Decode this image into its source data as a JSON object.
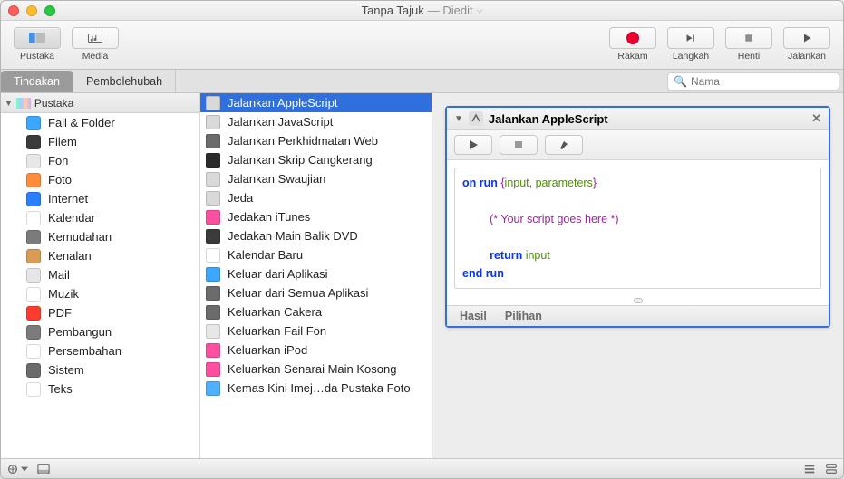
{
  "window": {
    "title": "Tanpa Tajuk",
    "status": "— Diedit"
  },
  "toolbar": {
    "pustaka": "Pustaka",
    "media": "Media",
    "rakam": "Rakam",
    "langkah": "Langkah",
    "henti": "Henti",
    "jalankan": "Jalankan"
  },
  "tabs": {
    "tindakan": "Tindakan",
    "pembolehubah": "Pembolehubah",
    "search_placeholder": "Nama"
  },
  "library": {
    "header": "Pustaka",
    "items": [
      {
        "label": "Fail & Folder",
        "bg": "#3ba7ff"
      },
      {
        "label": "Filem",
        "bg": "#3b3b3b"
      },
      {
        "label": "Fon",
        "bg": "#e7e7e7"
      },
      {
        "label": "Foto",
        "bg": "#ff8c3b"
      },
      {
        "label": "Internet",
        "bg": "#2a7fff"
      },
      {
        "label": "Kalendar",
        "bg": "#ffffff"
      },
      {
        "label": "Kemudahan",
        "bg": "#7b7b7b"
      },
      {
        "label": "Kenalan",
        "bg": "#d99b55"
      },
      {
        "label": "Mail",
        "bg": "#e6e6e6"
      },
      {
        "label": "Muzik",
        "bg": "#ffffff"
      },
      {
        "label": "PDF",
        "bg": "#ff3b30"
      },
      {
        "label": "Pembangun",
        "bg": "#7b7b7b"
      },
      {
        "label": "Persembahan",
        "bg": "#ffffff"
      },
      {
        "label": "Sistem",
        "bg": "#6b6b6b"
      },
      {
        "label": "Teks",
        "bg": "#ffffff"
      }
    ]
  },
  "actions": [
    {
      "label": "Jalankan AppleScript",
      "selected": true,
      "bg": "#d9d9d9"
    },
    {
      "label": "Jalankan JavaScript",
      "selected": false,
      "bg": "#d9d9d9"
    },
    {
      "label": "Jalankan Perkhidmatan Web",
      "selected": false,
      "bg": "#6b6b6b"
    },
    {
      "label": "Jalankan Skrip Cangkerang",
      "selected": false,
      "bg": "#2b2b2b"
    },
    {
      "label": "Jalankan Swaujian",
      "selected": false,
      "bg": "#d9d9d9"
    },
    {
      "label": "Jeda",
      "selected": false,
      "bg": "#d9d9d9"
    },
    {
      "label": "Jedakan iTunes",
      "selected": false,
      "bg": "#ff4fa0"
    },
    {
      "label": "Jedakan Main Balik DVD",
      "selected": false,
      "bg": "#3b3b3b"
    },
    {
      "label": "Kalendar Baru",
      "selected": false,
      "bg": "#ffffff"
    },
    {
      "label": "Keluar dari Aplikasi",
      "selected": false,
      "bg": "#3ba7ff"
    },
    {
      "label": "Keluar dari Semua Aplikasi",
      "selected": false,
      "bg": "#6b6b6b"
    },
    {
      "label": "Keluarkan Cakera",
      "selected": false,
      "bg": "#6b6b6b"
    },
    {
      "label": "Keluarkan Fail Fon",
      "selected": false,
      "bg": "#e7e7e7"
    },
    {
      "label": "Keluarkan iPod",
      "selected": false,
      "bg": "#ff4fa0"
    },
    {
      "label": "Keluarkan Senarai Main Kosong",
      "selected": false,
      "bg": "#ff4fa0"
    },
    {
      "label": "Kemas Kini Imej…da Pustaka Foto",
      "selected": false,
      "bg": "#4fb0ff"
    }
  ],
  "workflow_action": {
    "title": "Jalankan AppleScript",
    "code": {
      "l1a": "on run ",
      "l1b": "{",
      "l1c": "input",
      "l1d": ", ",
      "l1e": "parameters",
      "l1f": "}",
      "l2": "(* Your script goes here *)",
      "l3a": "return ",
      "l3b": "input",
      "l4": "end run"
    },
    "footer": {
      "hasil": "Hasil",
      "pilihan": "Pilihan"
    }
  }
}
